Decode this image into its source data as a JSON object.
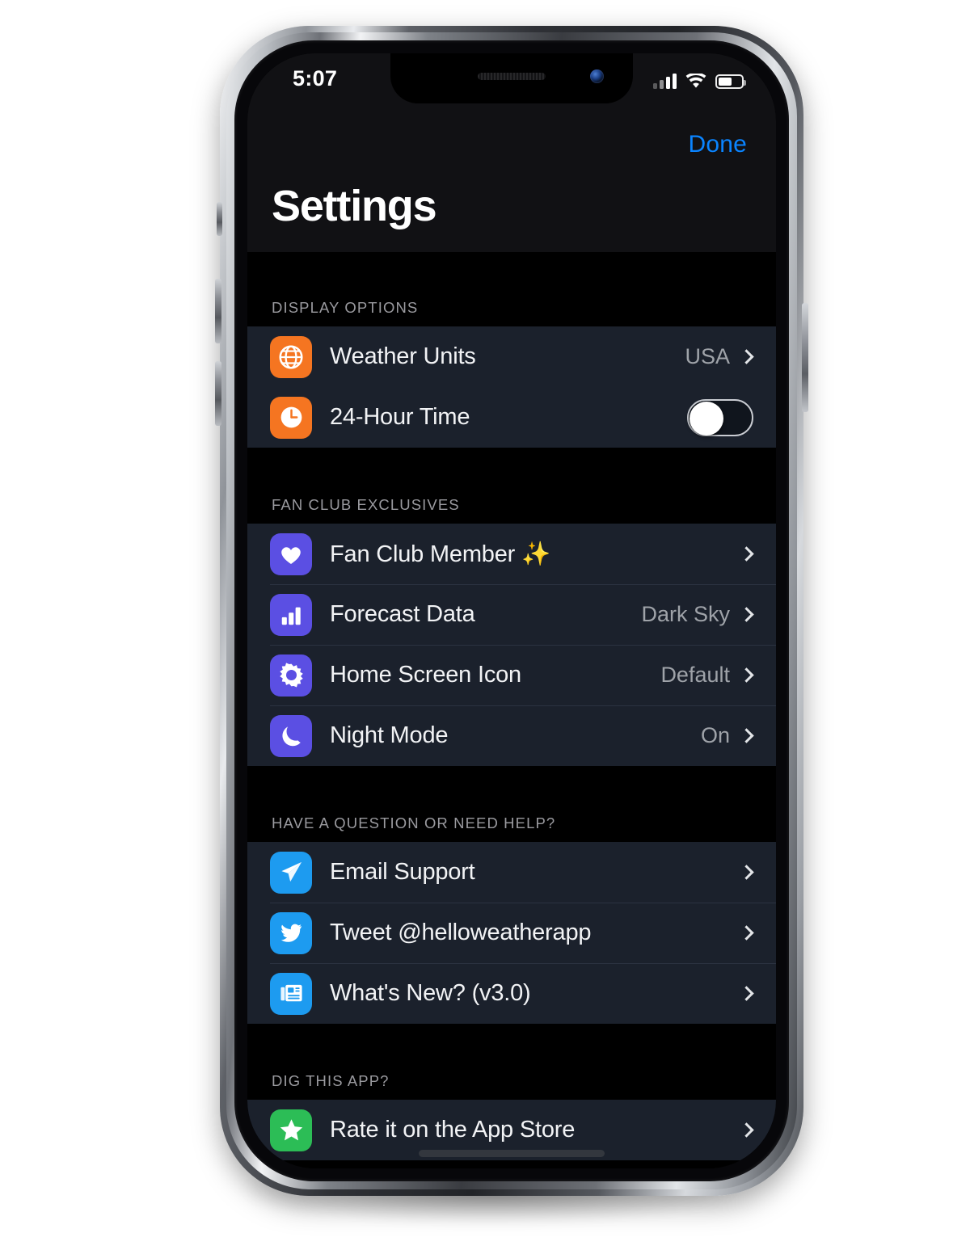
{
  "status_bar": {
    "time": "5:07",
    "signal_icon": "cellular-bars-icon",
    "wifi_icon": "wifi-icon",
    "battery_icon": "battery-icon",
    "battery_level": "60%"
  },
  "nav": {
    "done_label": "Done",
    "title": "Settings"
  },
  "sections": [
    {
      "header": "DISPLAY OPTIONS",
      "rows": [
        {
          "icon": "globe-icon",
          "icon_color": "#f57521",
          "label": "Weather Units",
          "value": "USA",
          "accessory": "chevron"
        },
        {
          "icon": "clock-icon",
          "icon_color": "#f57521",
          "label": "24-Hour Time",
          "value": "",
          "accessory": "toggle",
          "toggle_on": false
        }
      ]
    },
    {
      "header": "FAN CLUB EXCLUSIVES",
      "rows": [
        {
          "icon": "heart-icon",
          "icon_color": "#5b4fe3",
          "label": "Fan Club Member",
          "emoji": "✨",
          "value": "",
          "accessory": "chevron"
        },
        {
          "icon": "bar-chart-icon",
          "icon_color": "#5b4fe3",
          "label": "Forecast Data",
          "value": "Dark Sky",
          "accessory": "chevron"
        },
        {
          "icon": "sun-icon",
          "icon_color": "#5b4fe3",
          "label": "Home Screen Icon",
          "value": "Default",
          "accessory": "chevron"
        },
        {
          "icon": "moon-icon",
          "icon_color": "#5b4fe3",
          "label": "Night Mode",
          "value": "On",
          "accessory": "chevron"
        }
      ]
    },
    {
      "header": "HAVE A QUESTION OR NEED HELP?",
      "rows": [
        {
          "icon": "paper-plane-icon",
          "icon_color": "#1d9bf0",
          "label": "Email Support",
          "value": "",
          "accessory": "chevron"
        },
        {
          "icon": "twitter-bird-icon",
          "icon_color": "#1d9bf0",
          "label": "Tweet @helloweatherapp",
          "value": "",
          "accessory": "chevron"
        },
        {
          "icon": "newspaper-icon",
          "icon_color": "#1d9bf0",
          "label": "What's New? (v3.0)",
          "value": "",
          "accessory": "chevron"
        }
      ]
    },
    {
      "header": "DIG THIS APP?",
      "rows": [
        {
          "icon": "star-icon",
          "icon_color": "#2cbd56",
          "label": "Rate it on the App Store",
          "value": "",
          "accessory": "chevron"
        }
      ]
    }
  ],
  "colors": {
    "accent_blue": "#0a84ff",
    "screen_background": "#000000",
    "nav_background": "#111114",
    "card_background": "#1b212c",
    "separator": "#2b3240",
    "section_header_text": "#9a9a9f",
    "row_value_text": "#9fa3a9"
  }
}
